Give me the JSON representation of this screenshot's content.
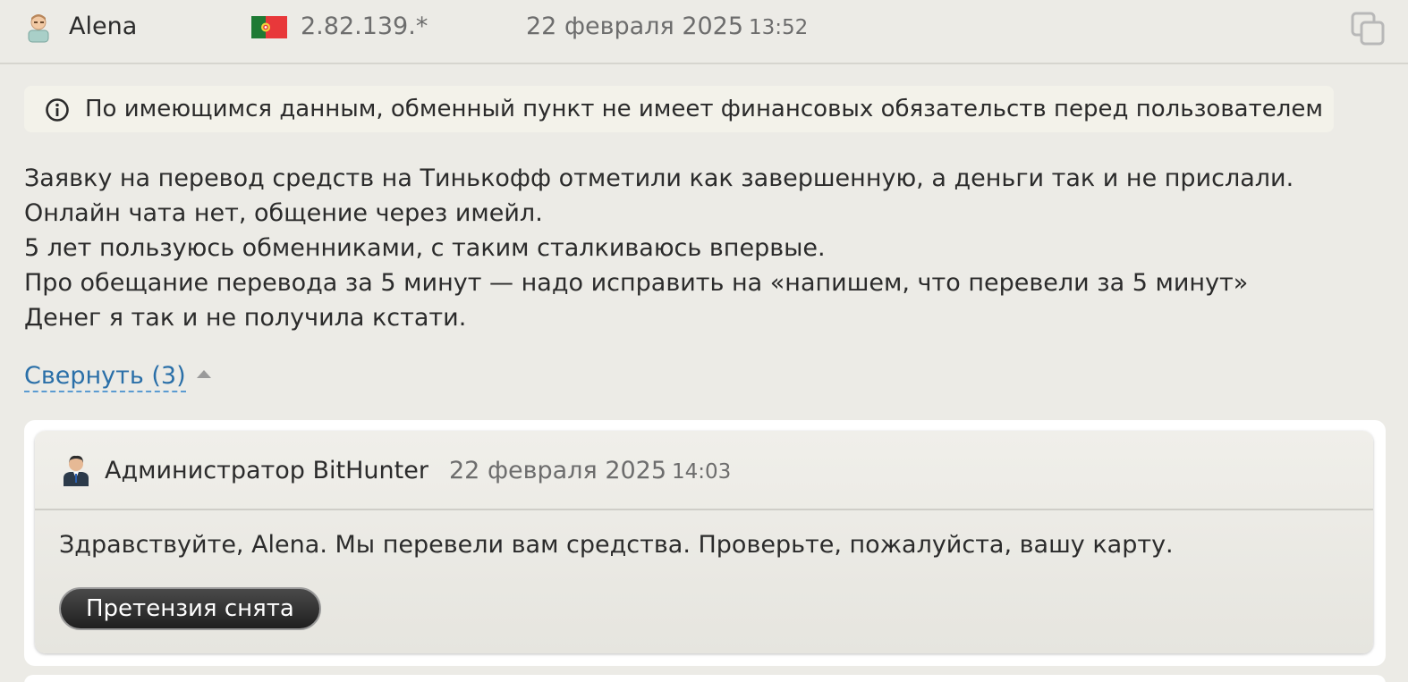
{
  "review": {
    "author": "Alena",
    "ip": "2.82.139.*",
    "date": "22 февраля 2025",
    "time": "13:52",
    "flag_country": "Portugal",
    "notice": "По имеющимся данным, обменный пункт не имеет финансовых обязательств перед пользователем",
    "lines": [
      "Заявку на перевод средств на Тинькофф отметили как завершенную, а деньги так и не прислали. Онлайн чата нет, общение через имейл.",
      "5 лет пользуюсь обменниками, с таким сталкиваюсь впервые.",
      "Про обещание перевода за 5 минут — надо исправить на «напишем, что перевели за 5 минут»",
      "Денег я так и не получила кстати."
    ],
    "collapse_label": "Свернуть (3)"
  },
  "reply": {
    "author": "Администратор BitHunter",
    "date": "22 февраля 2025",
    "time": "14:03",
    "text": "Здравствуйте, Alena. Мы перевели вам средства. Проверьте, пожалуйста, вашу карту.",
    "status_label": "Претензия снята"
  },
  "icons": {
    "user": "user-avatar-icon",
    "admin": "admin-avatar-icon",
    "flag": "portugal-flag-icon",
    "copy": "copy-icon",
    "info": "info-icon",
    "collapse": "triangle-up-icon"
  },
  "colors": {
    "background": "#ecebe6",
    "link": "#2a6fa8",
    "muted": "#6d6d6d",
    "button": "#2b2b2b"
  }
}
